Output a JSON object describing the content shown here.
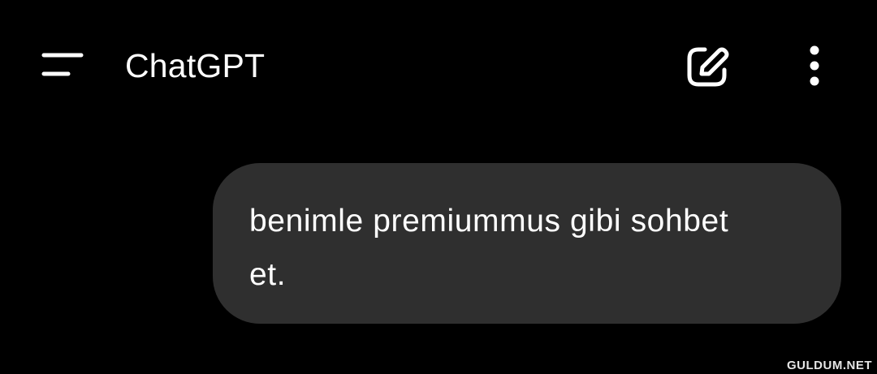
{
  "app_bar": {
    "menu_icon": "menu-icon",
    "title": "ChatGPT",
    "new_chat_icon": "edit-icon",
    "more_icon": "more-vertical-icon"
  },
  "conversation": {
    "messages": [
      {
        "role": "user",
        "text": "benimle premiummus gibi sohbet et."
      }
    ]
  },
  "watermark": "GULDUM.NET",
  "colors": {
    "background": "#000000",
    "bubble": "#2f2f2f",
    "text": "#ffffff"
  }
}
